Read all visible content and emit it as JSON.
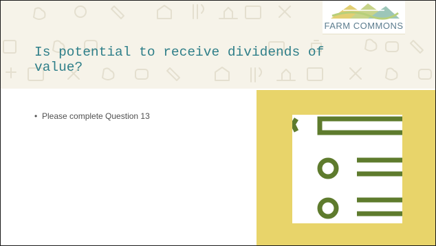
{
  "header": {
    "logo_text": "FARM COMMONS",
    "background_icons": [
      "chicken-icon",
      "grapes-icon",
      "pencil-icon",
      "barn-icon",
      "utensils-icon",
      "tractor-icon",
      "calendar-icon",
      "tools-icon",
      "sprout-icon"
    ]
  },
  "slide": {
    "title": "Is potential to receive dividends of value?"
  },
  "content": {
    "bullets": [
      {
        "marker": "•",
        "text": "Please complete Question 13"
      }
    ]
  },
  "illustration": {
    "icon": "checklist-icon"
  },
  "colors": {
    "title": "#2f7f89",
    "panel": "#e8d46a",
    "icon_green": "#5e7b2d",
    "header_band": "#f6f3e9",
    "logo_text": "#5b7c8e"
  }
}
